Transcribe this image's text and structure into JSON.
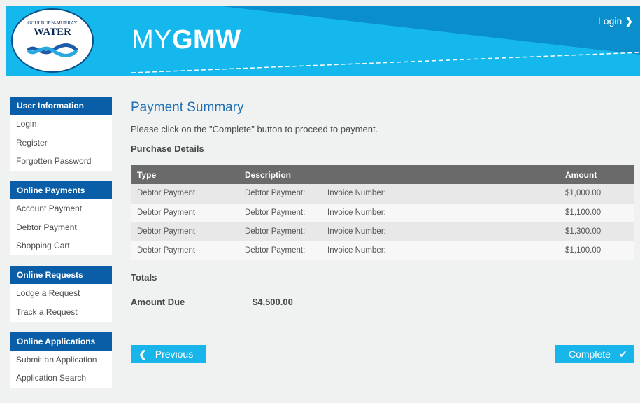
{
  "header": {
    "logo_line1": "GOULBURN-MURRAY",
    "logo_line2": "WATER",
    "brand_prefix": "MY",
    "brand_bold": "GMW",
    "login_label": "Login",
    "login_chevron": "❯"
  },
  "sidebar": {
    "groups": [
      {
        "title": "User Information",
        "items": [
          "Login",
          "Register",
          "Forgotten Password"
        ]
      },
      {
        "title": "Online Payments",
        "items": [
          "Account Payment",
          "Debtor Payment",
          "Shopping Cart"
        ]
      },
      {
        "title": "Online Requests",
        "items": [
          "Lodge a Request",
          "Track a Request"
        ]
      },
      {
        "title": "Online Applications",
        "items": [
          "Submit an Application",
          "Application Search"
        ]
      }
    ]
  },
  "main": {
    "title": "Payment Summary",
    "instruction": "Please click on the \"Complete\" button to proceed to payment.",
    "purchase_details": "Purchase Details",
    "table": {
      "headers": {
        "type": "Type",
        "description": "Description",
        "amount": "Amount"
      },
      "rows": [
        {
          "type": "Debtor Payment",
          "desc1": "Debtor Payment:",
          "desc2": "Invoice Number:",
          "amount": "$1,000.00"
        },
        {
          "type": "Debtor Payment",
          "desc1": "Debtor Payment:",
          "desc2": "Invoice Number:",
          "amount": "$1,100.00"
        },
        {
          "type": "Debtor Payment",
          "desc1": "Debtor Payment:",
          "desc2": "Invoice Number:",
          "amount": "$1,300.00"
        },
        {
          "type": "Debtor Payment",
          "desc1": "Debtor Payment:",
          "desc2": "Invoice Number:",
          "amount": "$1,100.00"
        }
      ]
    },
    "totals": "Totals",
    "amount_due_label": "Amount Due",
    "amount_due_value": "$4,500.00"
  },
  "buttons": {
    "previous_label": "Previous",
    "previous_icon": "❮",
    "complete_label": "Complete",
    "complete_icon": "✔"
  },
  "colors": {
    "header_blue": "#12b3e8",
    "nav_dark_blue": "#0a5ea8",
    "title_blue": "#1e6fb4",
    "button_blue": "#17b5e9"
  }
}
